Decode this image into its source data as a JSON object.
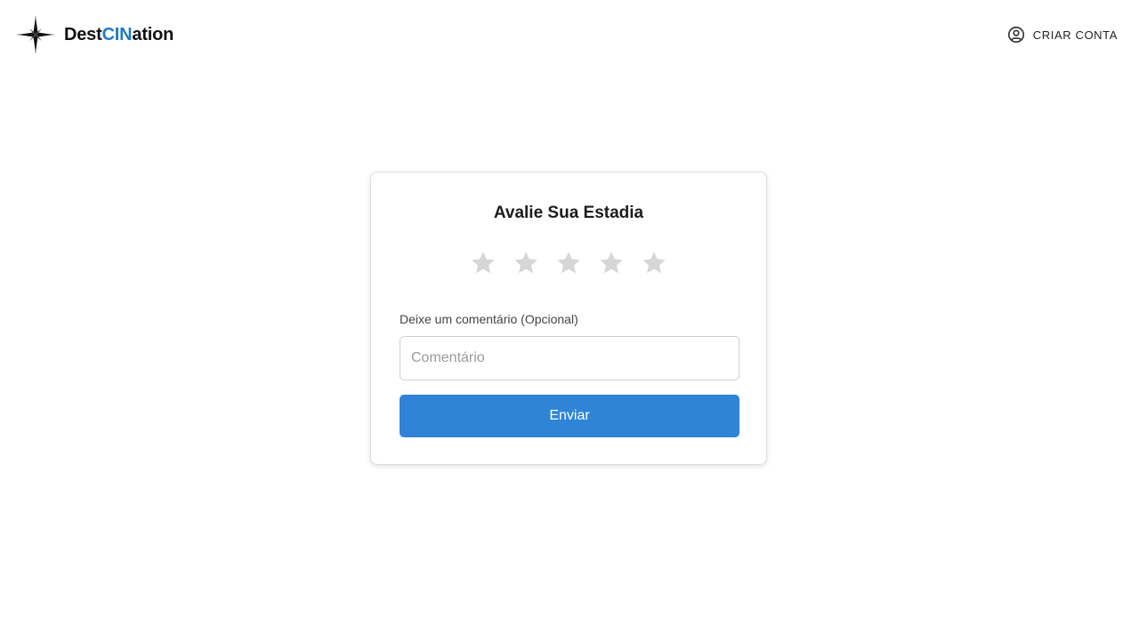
{
  "header": {
    "brand_prefix": "Dest",
    "brand_accent": "CIN",
    "brand_suffix": "ation",
    "logo_icon": "compass-star-icon",
    "account_icon": "user-circle-icon",
    "account_label": "CRIAR CONTA"
  },
  "review": {
    "title": "Avalie Sua Estadia",
    "star_icon": "star-icon",
    "rating": 0,
    "max_rating": 5,
    "comment_label": "Deixe um comentário (Opcional)",
    "comment_placeholder": "Comentário",
    "comment_value": "",
    "submit_label": "Enviar"
  },
  "colors": {
    "brand_accent": "#1f7bc6",
    "button": "#2f84d8",
    "star_inactive": "#d6d6d6"
  }
}
